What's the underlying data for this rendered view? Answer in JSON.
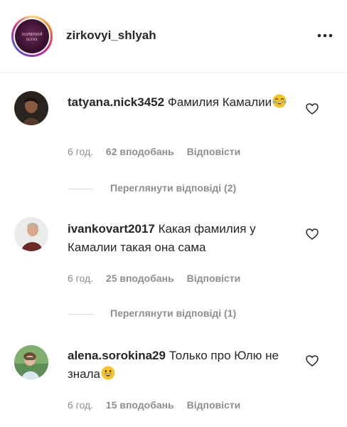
{
  "post": {
    "username": "zirkovyi_shlyah",
    "avatar_logo_line1": "ЗОРЯНИЙ",
    "avatar_logo_line2": "ШЛЯХ"
  },
  "comments": [
    {
      "author": "tatyana.nick3452",
      "text": "Фамилия Камалии",
      "emoji": "face-with-tears-of-joy",
      "time": "6 год.",
      "likes": "62 вподобань",
      "reply": "Відповісти",
      "view_replies": "Переглянути відповіді (2)"
    },
    {
      "author": "ivankovart2017",
      "text": "Какая фамилия у Камалии такая она сама",
      "time": "6 год.",
      "likes": "25 вподобань",
      "reply": "Відповісти",
      "view_replies": "Переглянути відповіді (1)"
    },
    {
      "author": "alena.sorokina29",
      "text": "Только про Юлю не знала",
      "emoji": "grinning-face",
      "time": "6 год.",
      "likes": "15 вподобань",
      "reply": "Відповісти"
    }
  ],
  "colors": {
    "text": "#262626",
    "secondary": "#8e8e8e",
    "divider": "#efefef"
  }
}
